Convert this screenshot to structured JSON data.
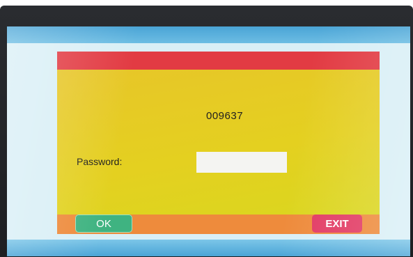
{
  "dialog": {
    "device_id": "009637",
    "password_label": "Password:",
    "password_value": "",
    "ok_label": "OK",
    "exit_label": "EXIT"
  },
  "colors": {
    "title_bar": "#e23b43",
    "dialog_body": "#e4d020",
    "footer": "#ee8b3c",
    "ok_button": "#3fb381",
    "exit_button": "#e23b64",
    "screen_bands": "#4aa4d6"
  }
}
